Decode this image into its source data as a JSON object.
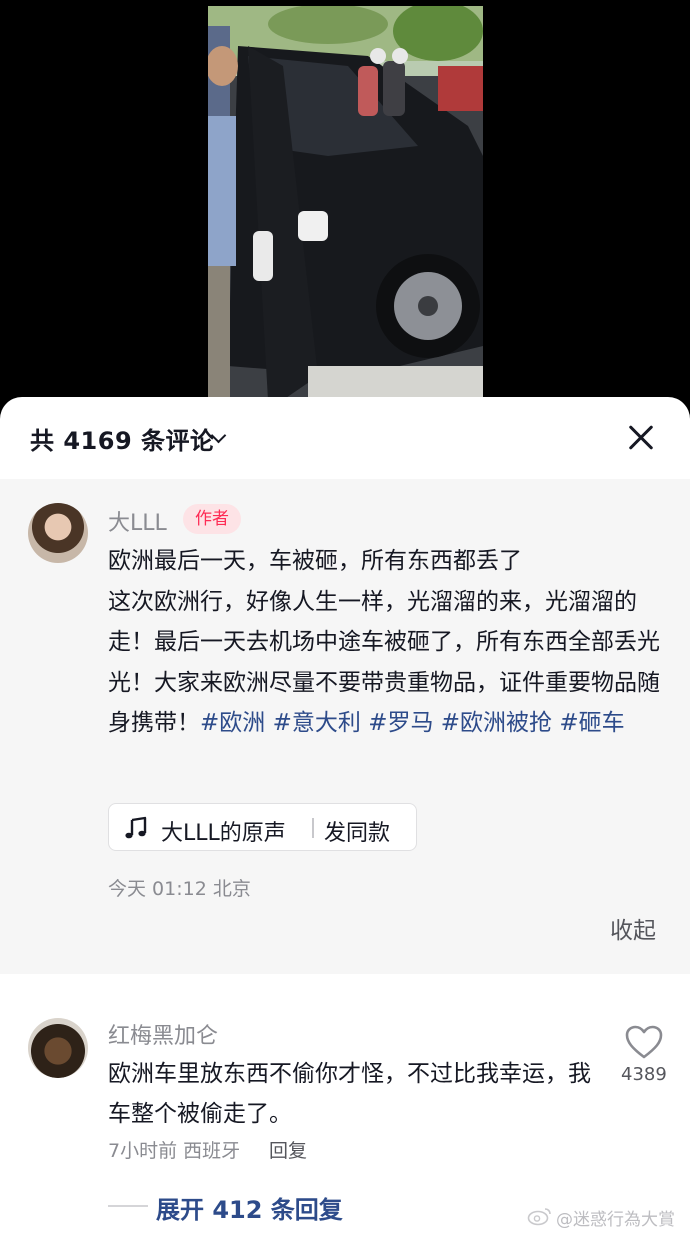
{
  "header": {
    "comment_count_title": "共 4169 条评论"
  },
  "author_comment": {
    "name": "大LLL",
    "tag": "作者",
    "line1": "欧洲最后一天，车被砸，所有东西都丢了",
    "body": "这次欧洲行，好像人生一样，光溜溜的来，光溜溜的走！最后一天去机场中途车被砸了，所有东西全部丢光光！大家来欧洲尽量不要带贵重物品，证件重要物品随身携带！",
    "hashtags": [
      "#欧洲",
      "#意大利",
      "#罗马",
      "#欧洲被抢",
      "#砸车"
    ],
    "sound_name": "大LLL的原声",
    "sound_action": "发同款",
    "meta": "今天 01:12 北京",
    "collapse_label": "收起"
  },
  "comment": {
    "name": "红梅黑加仑",
    "text": "欧洲车里放东西不偷你才怪，不过比我幸运，我车整个被偷走了。",
    "meta": "7小时前 西班牙",
    "reply_label": "回复",
    "like_count": "4389",
    "expand_label": "展开 412 条回复"
  },
  "watermark": "@迷惑行為大賞",
  "icons": {
    "close": "close-icon",
    "chevron": "chevron-down-icon",
    "music_note": "music-note-icon",
    "heart": "heart-icon",
    "weibo": "weibo-icon"
  },
  "colors": {
    "hashtag": "#2d4b8a",
    "author_tag_text": "#fe2c55",
    "author_tag_bg": "#fde3e6",
    "secondary_text": "#8a8b91"
  }
}
